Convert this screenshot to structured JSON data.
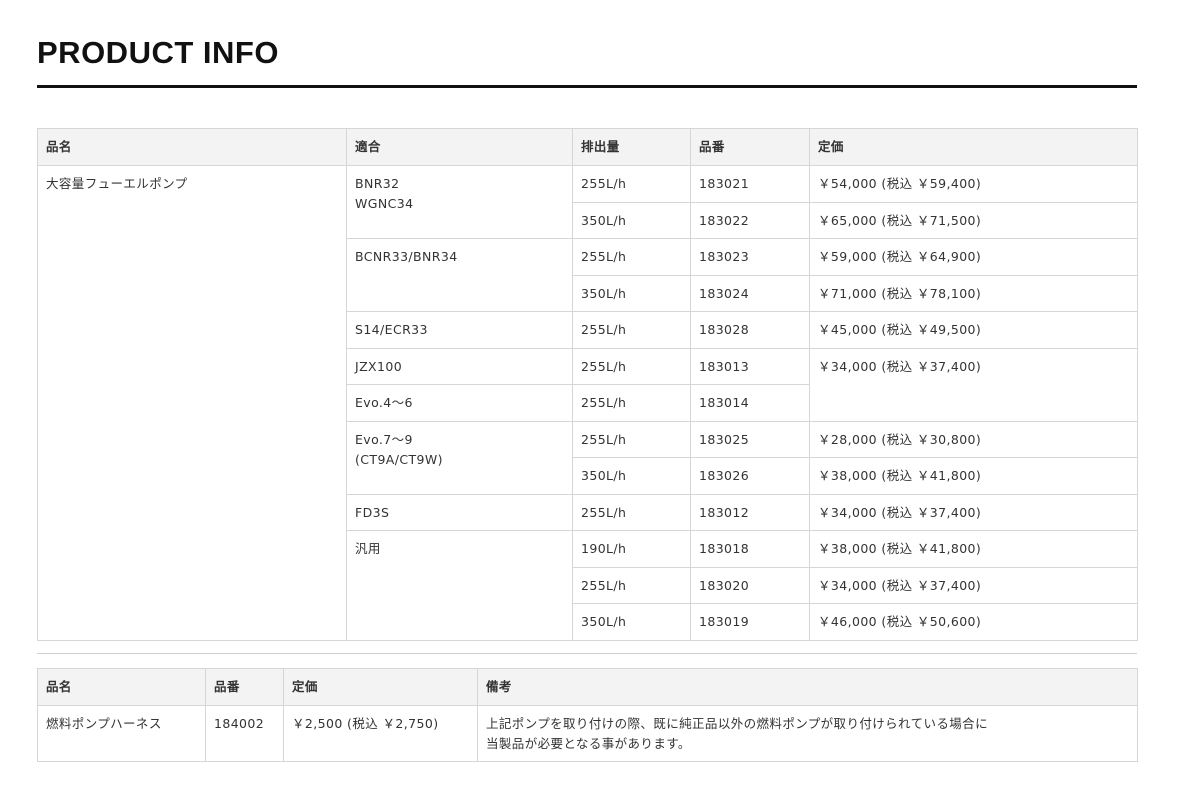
{
  "title": "PRODUCT INFO",
  "table1": {
    "headers": [
      "品名",
      "適合",
      "排出量",
      "品番",
      "定価"
    ],
    "product_name": "大容量フューエルポンプ",
    "rows": [
      {
        "fit": [
          "BNR32",
          "WGNC34"
        ],
        "displacement": "255L/h",
        "part_no": "183021",
        "price": "￥54,000 (税込 ￥59,400)"
      },
      {
        "displacement": "350L/h",
        "part_no": "183022",
        "price": "￥65,000 (税込 ￥71,500)"
      },
      {
        "fit": [
          "BCNR33/BNR34"
        ],
        "displacement": "255L/h",
        "part_no": "183023",
        "price": "￥59,000 (税込 ￥64,900)"
      },
      {
        "displacement": "350L/h",
        "part_no": "183024",
        "price": "￥71,000 (税込 ￥78,100)"
      },
      {
        "fit": [
          "S14/ECR33"
        ],
        "displacement": "255L/h",
        "part_no": "183028",
        "price": "￥45,000 (税込 ￥49,500)"
      },
      {
        "fit": [
          "JZX100"
        ],
        "displacement": "255L/h",
        "part_no": "183013",
        "price": "￥34,000 (税込 ￥37,400)"
      },
      {
        "fit": [
          "Evo.4〜6"
        ],
        "displacement": "255L/h",
        "part_no": "183014"
      },
      {
        "fit": [
          "Evo.7〜9",
          "(CT9A/CT9W)"
        ],
        "displacement": "255L/h",
        "part_no": "183025",
        "price": "￥28,000 (税込 ￥30,800)"
      },
      {
        "displacement": "350L/h",
        "part_no": "183026",
        "price": "￥38,000 (税込 ￥41,800)"
      },
      {
        "fit": [
          "FD3S"
        ],
        "displacement": "255L/h",
        "part_no": "183012",
        "price": "￥34,000 (税込 ￥37,400)"
      },
      {
        "fit": [
          "汎用"
        ],
        "displacement": "190L/h",
        "part_no": "183018",
        "price": "￥38,000 (税込 ￥41,800)"
      },
      {
        "displacement": "255L/h",
        "part_no": "183020",
        "price": "￥34,000 (税込 ￥37,400)"
      },
      {
        "displacement": "350L/h",
        "part_no": "183019",
        "price": "￥46,000 (税込 ￥50,600)"
      }
    ]
  },
  "table2": {
    "headers": [
      "品名",
      "品番",
      "定価",
      "備考"
    ],
    "rows": [
      {
        "name": "燃料ポンプハーネス",
        "part_no": "184002",
        "price": "￥2,500 (税込 ￥2,750)",
        "note": [
          "上記ポンプを取り付けの際、既に純正品以外の燃料ポンプが取り付けられている場合に",
          "当製品が必要となる事があります。"
        ]
      }
    ]
  }
}
